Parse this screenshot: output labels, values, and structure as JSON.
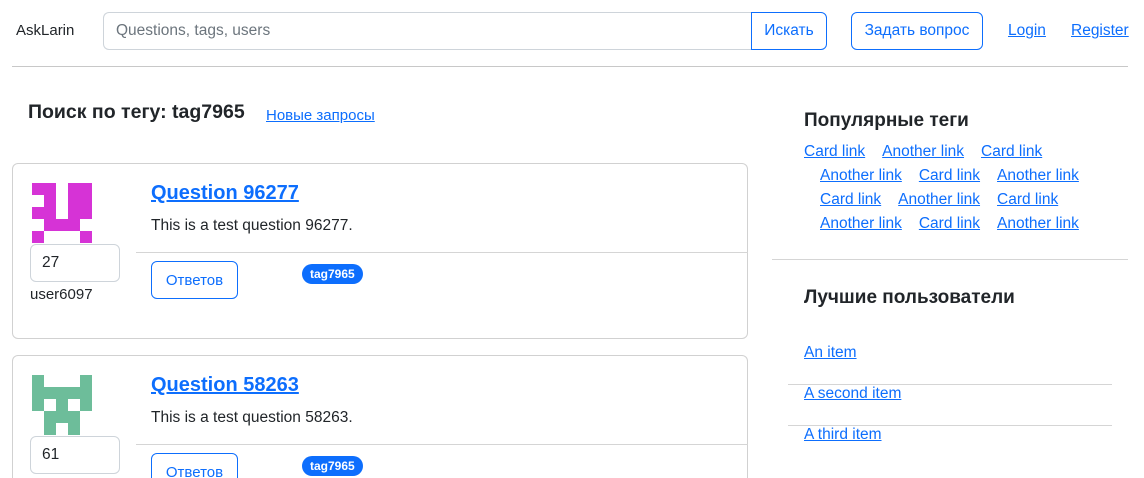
{
  "header": {
    "brand": "AskLarin",
    "search_placeholder": "Questions, tags, users",
    "search_button": "Искать",
    "ask_button": "Задать вопрос",
    "login": "Login",
    "register": "Register"
  },
  "main": {
    "title": "Поиск по тегу: tag7965",
    "new_link": "Новые запросы",
    "questions": [
      {
        "title": "Question 96277",
        "text": "This is a test question 96277.",
        "rating": "27",
        "user": "user6097",
        "answers_label": "Ответов",
        "tag": "tag7965",
        "avatar_color": "#d633d6"
      },
      {
        "title": "Question 58263",
        "text": "This is a test question 58263.",
        "rating": "61",
        "answers_label": "Ответов",
        "tag": "tag7965",
        "avatar_color": "#6dbd9a"
      }
    ]
  },
  "sidebar": {
    "popular_title": "Популярные теги",
    "tag_rows": [
      [
        "Card link",
        "Another link",
        "Card link"
      ],
      [
        "Another link",
        "Card link",
        "Another link"
      ],
      [
        "Card link",
        "Another link",
        "Card link"
      ],
      [
        "Another link",
        "Card link",
        "Another link"
      ]
    ],
    "best_title": "Лучшие пользователи",
    "users": [
      "An item",
      "A second item",
      "A third item"
    ]
  },
  "colors": {
    "primary": "#0d6efd",
    "text": "#212529",
    "border": "#ced4da"
  }
}
